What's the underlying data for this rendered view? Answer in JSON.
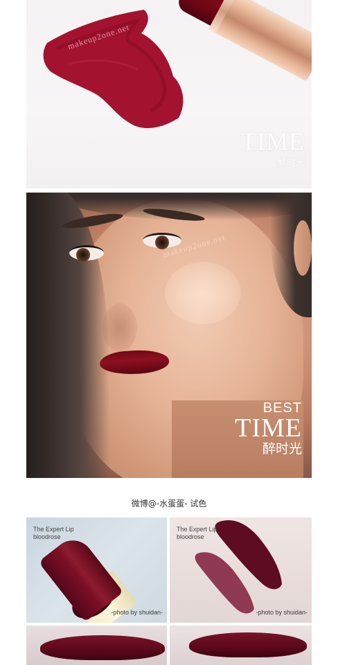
{
  "panels": {
    "swatch": {
      "logo_big": "TIME",
      "logo_small": "醉时光",
      "watermark": "makeup2one.net"
    },
    "portrait": {
      "logo_best": "BEST",
      "logo_time": "TIME",
      "logo_cn": "醉时光",
      "watermark": "makeup2one.net"
    }
  },
  "caption": "微博@-水蛋蛋- 试色",
  "tiles": [
    {
      "label_line1": "The Expert Lip",
      "label_line2": "bloodrose",
      "credit": "-photo by shuidan-"
    },
    {
      "label_line1": "The Expert Lip",
      "label_line2": "bloodrose",
      "credit": "-photo by shuidan-"
    }
  ],
  "colors": {
    "lipstick": "#8c1021",
    "tube_gold": "#e8b89a",
    "swatch_red": "#a3122e"
  }
}
